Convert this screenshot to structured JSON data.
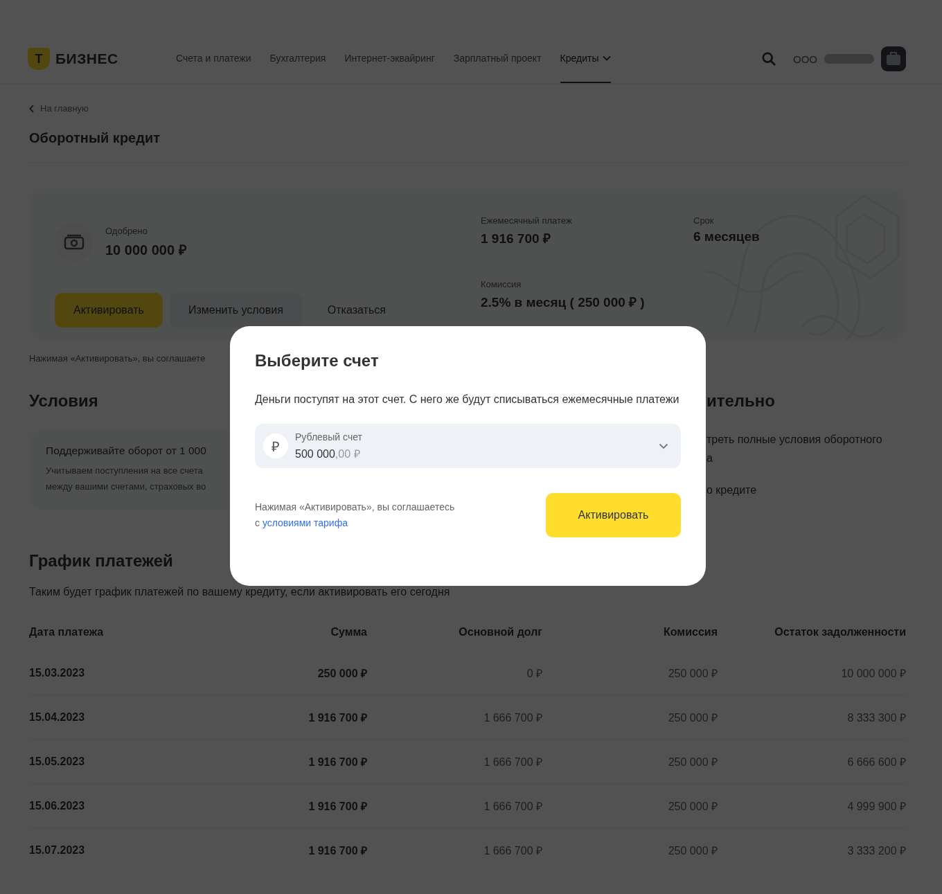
{
  "header": {
    "logo_mark": "Т",
    "logo_text": "БИЗНЕС",
    "nav": [
      {
        "label": "Счета и платежи",
        "selected": false
      },
      {
        "label": "Бухгалтерия",
        "selected": false
      },
      {
        "label": "Интернет-эквайринг",
        "selected": false
      },
      {
        "label": "Зарплатный проект",
        "selected": false
      },
      {
        "label": "Кредиты",
        "selected": true
      }
    ],
    "org": "ООО"
  },
  "back_link": "На главную",
  "title": "Оборотный кредит",
  "offer": {
    "approved_label": "Одобрено",
    "approved_value": "10 000 000 ₽",
    "monthly_label": "Ежемесячный платеж",
    "monthly_value": "1 916 700 ₽",
    "term_label": "Срок",
    "term_value": "6 месяцев",
    "commission_label": "Комиссия",
    "commission_value": "2.5% в месяц ( 250 000 ₽ )",
    "buttons": [
      {
        "label": "Активировать",
        "kind": "primary"
      },
      {
        "label": "Изменить условия",
        "kind": "secondary"
      },
      {
        "label": "Отказаться",
        "kind": "ghost"
      }
    ]
  },
  "offer_note": "Нажимая «Активировать», вы соглашаете",
  "conditions": {
    "title": "Условия",
    "card_title": "Поддерживайте оборот от 1 000",
    "card_lines": [
      "Учитываем поступления на все счета",
      "между вашими счетами, страховых во"
    ]
  },
  "additional": {
    "title": "ительно",
    "lines": [
      "треть полные условия оборотного",
      "а",
      "о кредите"
    ]
  },
  "schedule": {
    "title": "График платежей",
    "subtitle": "Таким будет график платежей по вашему кредиту, если активировать его сегодня",
    "columns": [
      "Дата платежа",
      "Сумма",
      "Основной долг",
      "Комиссия",
      "Остаток задолженности"
    ],
    "rows": [
      {
        "cells": [
          "15.03.2023",
          "250 000 ₽",
          "0 ₽",
          "250 000 ₽",
          "10 000 000 ₽"
        ]
      },
      {
        "cells": [
          "15.04.2023",
          "1 916 700 ₽",
          "1 666 700 ₽",
          "250 000 ₽",
          "8 333 300 ₽"
        ]
      },
      {
        "cells": [
          "15.05.2023",
          "1 916 700 ₽",
          "1 666 700 ₽",
          "250 000 ₽",
          "6 666 600 ₽"
        ]
      },
      {
        "cells": [
          "15.06.2023",
          "1 916 700 ₽",
          "1 666 700 ₽",
          "250 000 ₽",
          "4 999 900 ₽"
        ]
      },
      {
        "cells": [
          "15.07.2023",
          "1 916 700 ₽",
          "1 666 700 ₽",
          "250 000 ₽",
          "3 333 200 ₽"
        ]
      }
    ]
  },
  "modal": {
    "title": "Выберите счет",
    "text": "Деньги поступят на этот счет. С него же будут списываться ежемесячные платежи",
    "account": {
      "currency_mark": "₽",
      "label": "Рублевый счет",
      "amount": "500 000",
      "fraction": ",00 ₽"
    },
    "note": "Нажимая «Активировать», вы соглашаетесь",
    "note_prefix": "с",
    "note_link": "условиями тарифа",
    "button": "Активировать"
  }
}
